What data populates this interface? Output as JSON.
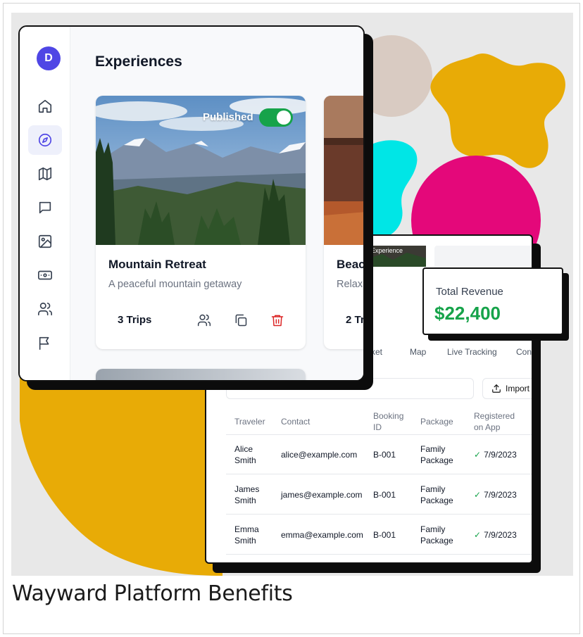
{
  "caption": "Wayward Platform Benefits",
  "colors": {
    "yellow_blob": "#e8ab06",
    "pink_blob": "#e4087a",
    "cyan_blob": "#00e6e6",
    "beige_blob": "#d9cbc2",
    "accent": "#4f46e5",
    "success": "#16a34a",
    "danger": "#dc2626"
  },
  "sidebar": {
    "avatar_initial": "D",
    "items": [
      {
        "icon": "home-icon"
      },
      {
        "icon": "compass-icon",
        "active": true
      },
      {
        "icon": "map-icon"
      },
      {
        "icon": "message-icon"
      },
      {
        "icon": "image-icon"
      },
      {
        "icon": "ticket-icon"
      },
      {
        "icon": "users-icon"
      },
      {
        "icon": "flag-icon"
      }
    ]
  },
  "experiences": {
    "title": "Experiences",
    "cards": [
      {
        "title": "Mountain Retreat",
        "description": "A peaceful mountain getaway",
        "trips": "3 Trips",
        "status_label": "Published",
        "published": true
      },
      {
        "title": "Beac",
        "description": "Relax",
        "trips": "2 Tr"
      }
    ]
  },
  "travelers": {
    "thumbnail_label": "Experience",
    "tabs": [
      "cket",
      "Map",
      "Live Tracking",
      "Cont"
    ],
    "import_label": "Import C",
    "columns": [
      "Traveler",
      "Contact",
      "Booking ID",
      "Package",
      "Registered on App"
    ],
    "rows": [
      {
        "name": "Alice Smith",
        "contact": "alice@example.com",
        "booking": "B-001",
        "package": "Family Package",
        "registered": "7/9/2023"
      },
      {
        "name": "James Smith",
        "contact": "james@example.com",
        "booking": "B-001",
        "package": "Family Package",
        "registered": "7/9/2023"
      },
      {
        "name": "Emma Smith",
        "contact": "emma@example.com",
        "booking": "B-001",
        "package": "Family Package",
        "registered": "7/9/2023"
      }
    ]
  },
  "revenue": {
    "label": "Total Revenue",
    "value": "$22,400"
  }
}
